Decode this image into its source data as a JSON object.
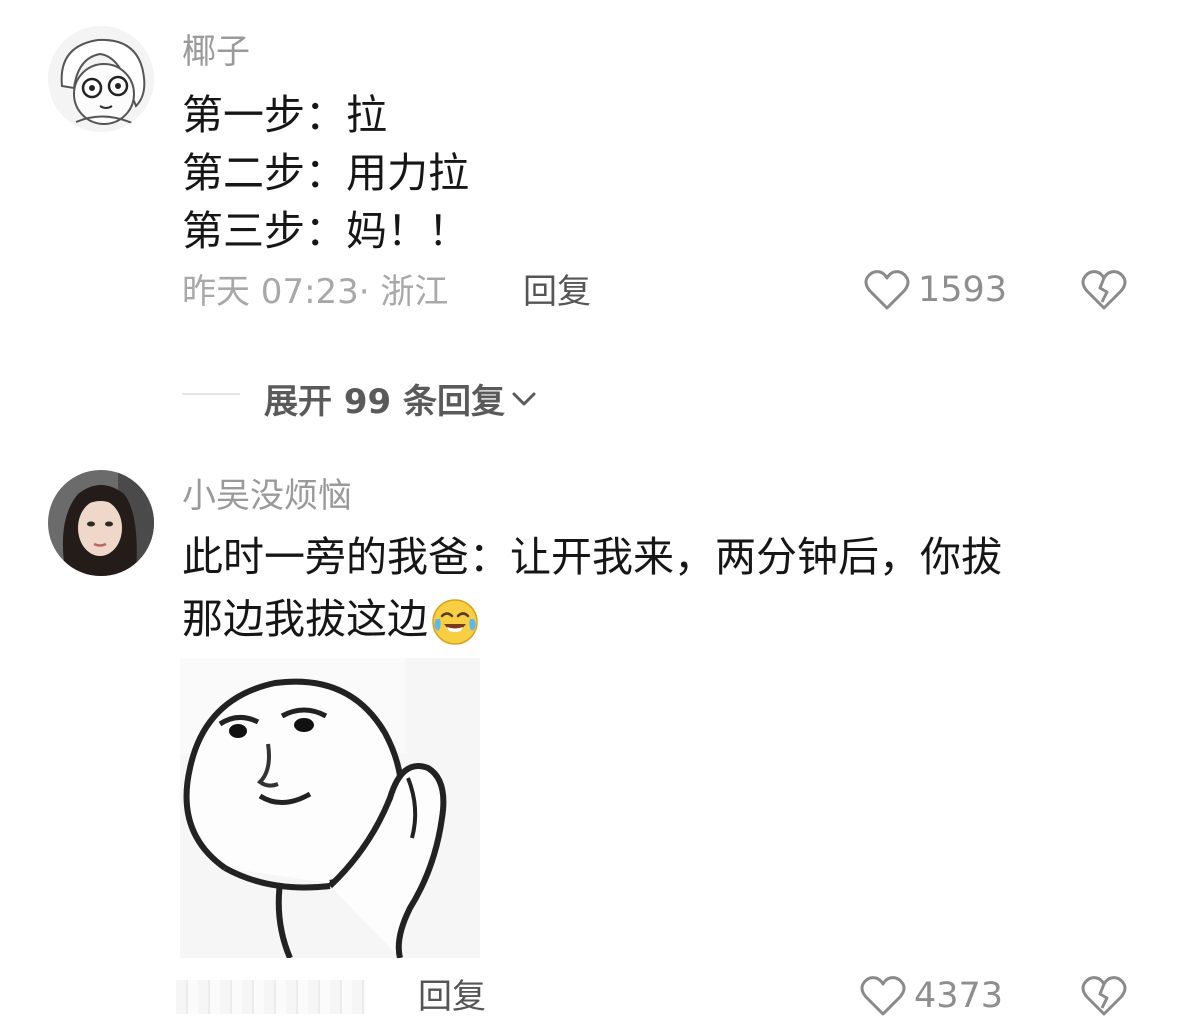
{
  "comments": [
    {
      "username": "椰子",
      "lines": [
        "第一步：拉",
        "第二步：用力拉",
        "第三步：妈！！"
      ],
      "timestamp": "昨天 07:23",
      "location": "· 浙江",
      "reply_label": "回复",
      "likes": "1593",
      "expand_label": "展开 99 条回复"
    },
    {
      "username": "小吴没烦恼",
      "lines": [
        "此时一旁的我爸：让开我来，两分钟后，你拔",
        "那边我拔这边"
      ],
      "reply_label": "回复",
      "likes": "4373"
    }
  ],
  "icons": {
    "like": "heart-outline-icon",
    "dislike": "broken-heart-icon",
    "expand": "chevron-down-icon",
    "emoji": "tears-of-joy-emoji"
  }
}
